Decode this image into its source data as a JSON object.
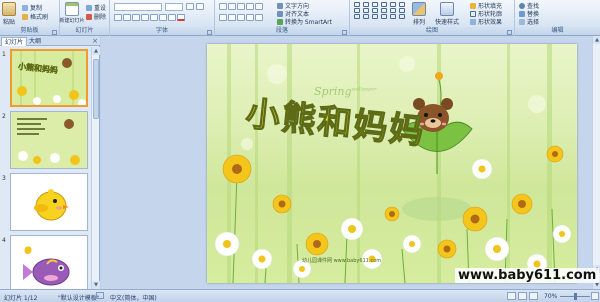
{
  "ribbon": {
    "groups": [
      {
        "label": "剪贴板"
      },
      {
        "label": "幻灯片"
      },
      {
        "label": "字体"
      },
      {
        "label": "段落"
      },
      {
        "label": "绘图"
      },
      {
        "label": "编辑"
      }
    ],
    "clipboard": {
      "paste": "粘贴",
      "copy": "复制",
      "format_painter": "格式刷"
    },
    "slides": {
      "new_slide": "新建幻灯片",
      "reset": "重设",
      "delete": "删除"
    },
    "paragraph": {
      "text_direction": "文字方向",
      "align_text": "对齐文本",
      "smartart": "转换为 SmartArt"
    },
    "drawing": {
      "arrange": "排列",
      "quick_styles": "快速样式",
      "shape_fill": "形状填充",
      "shape_outline": "形状轮廓",
      "shape_effects": "形状效果"
    },
    "editing": {
      "find": "查找",
      "replace": "替换",
      "select": "选择"
    }
  },
  "left_pane": {
    "tabs": [
      "幻灯片",
      "大纲"
    ],
    "close_glyph": "×",
    "slide_numbers": [
      "1",
      "2",
      "3",
      "4"
    ],
    "thumb_title": "小熊和妈妈"
  },
  "slide": {
    "title": "小熊和妈妈",
    "spring": "Spring",
    "spring_sup": "wallpaper",
    "footer": "幼儿园课件网 www.baby611.com"
  },
  "watermark": "www.baby611.com",
  "status": {
    "slide_count": "幻灯片 1/12",
    "theme": "\"默认设计模板\"",
    "language": "中文(简体，中国)",
    "zoom": "70%"
  },
  "colors": {
    "ribbon_bg": "#dde8f5",
    "selected_border": "#f29a2e",
    "title_fill": "#e8e23a",
    "slide_green": "#cfe79a"
  },
  "icons": [
    "paste-icon",
    "copy-icon",
    "format-painter-icon",
    "new-slide-icon",
    "bold-icon",
    "italic-icon",
    "bullets-icon",
    "shapes-icon",
    "arrange-icon",
    "find-icon",
    "replace-icon",
    "select-icon",
    "normal-view-icon",
    "slide-sorter-icon",
    "slideshow-icon",
    "fit-icon"
  ]
}
